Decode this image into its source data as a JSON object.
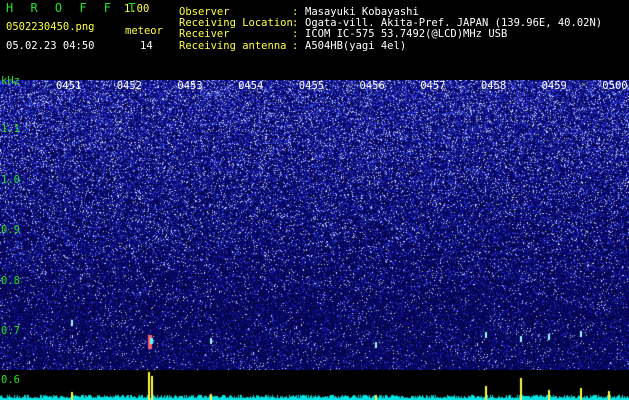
{
  "app": {
    "title": "H R O F F T",
    "version": "1.00"
  },
  "file": {
    "name": "0502230450.png",
    "datetime": "05.02.23 04:50"
  },
  "meteor": {
    "label": "meteor",
    "count": "14"
  },
  "info": [
    {
      "key": "Observer",
      "sep": ":",
      "value": "Masayuki Kobayashi"
    },
    {
      "key": "Receiving Location",
      "sep": ":",
      "value": "Ogata-vill. Akita-Pref. JAPAN (139.96E, 40.02N)"
    },
    {
      "key": "Receiver",
      "sep": ":",
      "value": "ICOM IC-575 53.7492(@LCD)MHz USB"
    },
    {
      "key": "Receiving antenna",
      "sep": ":",
      "value": "A504HB(yagi 4el)"
    }
  ],
  "axis": {
    "unit": "kHz",
    "time_ticks": [
      "0451",
      "0452",
      "0453",
      "0454",
      "0455",
      "0456",
      "0457",
      "0458",
      "0459",
      "0500"
    ],
    "freq_ticks": [
      "1.1",
      "1.0",
      "0.9",
      "0.8",
      "0.7",
      "0.6"
    ],
    "freq_range": [
      0.6,
      1.15
    ]
  },
  "colors": {
    "green": "#21e421",
    "white": "#ffffff",
    "yellow": "#ffff40",
    "background": "#000000"
  }
}
